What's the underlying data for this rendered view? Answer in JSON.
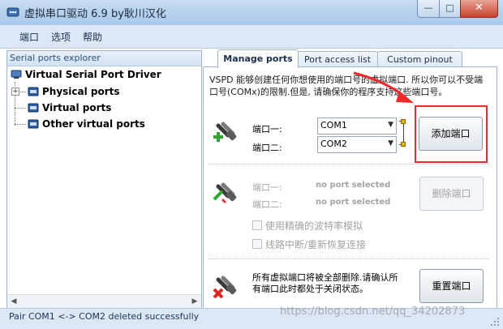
{
  "window": {
    "title": "虚拟串口驱动 6.9 by耿川汉化",
    "minimize_glyph": "—",
    "maximize_glyph": "□",
    "close_glyph": "✕"
  },
  "menu": [
    "端口",
    "选项",
    "帮助"
  ],
  "explorer": {
    "header": "Serial ports explorer",
    "root": "Virtual Serial Port Driver",
    "children": [
      "Physical ports",
      "Virtual ports",
      "Other virtual ports"
    ],
    "scroll_left": "◀",
    "scroll_right": "▶"
  },
  "tabs": [
    "Manage ports",
    "Port access list",
    "Custom pinout"
  ],
  "manage": {
    "description": "VSPD 能够创建任何你想使用的端口号的虚拟端口. 所以你可以不受端口号(COMx)的限制.但是, 请确保你的程序支持这些端口号。",
    "add": {
      "port1_label": "端口一:",
      "port2_label": "端口二:",
      "port1_value": "COM1",
      "port2_value": "COM2",
      "button": "添加端口"
    },
    "remove": {
      "port1_label": "端口一:",
      "port2_label": "端口二:",
      "port1_value": "no port selected",
      "port2_value": "no port selected",
      "button": "删除端口",
      "option_baud": "使用精确的波特率模拟",
      "option_reconnect": "线路中断/重新恢复连接"
    },
    "reset": {
      "text": "所有虚拟端口将被全部删除.请确认所有端口此时都处于关闭状态。",
      "button": "重置端口"
    }
  },
  "status": "Pair COM1 <-> COM2 deleted successfully",
  "watermark": "https://blog.csdn.net/qq_34202873",
  "colors": {
    "highlight": "#ef2a2a",
    "accent": "#27507f"
  }
}
